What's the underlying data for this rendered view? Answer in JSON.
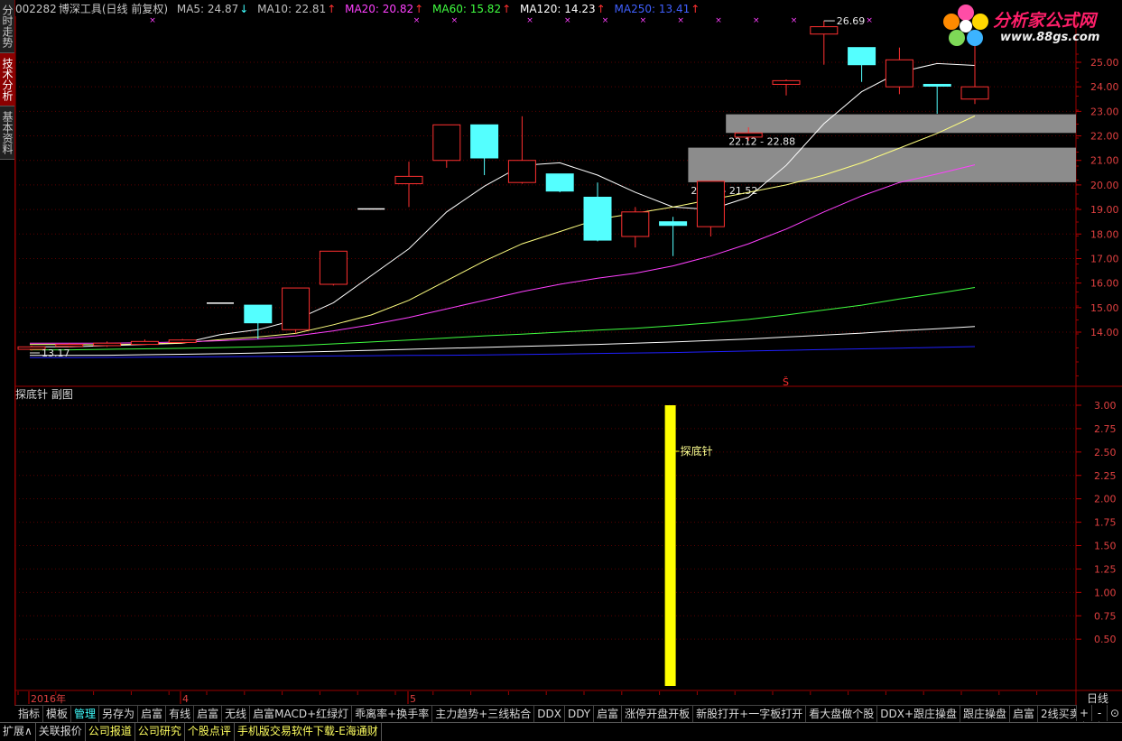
{
  "side_tabs": [
    {
      "label": "分时走势",
      "active": false
    },
    {
      "label": "技术分析",
      "active": true
    },
    {
      "label": "基本资料",
      "active": false
    }
  ],
  "header": {
    "code": "002282",
    "name": "博深工具",
    "mode": "(日线 前复权)",
    "ma": [
      {
        "label": "MA5: 24.87",
        "dir": "↓",
        "color": "#ffffff"
      },
      {
        "label": "MA10: 22.81",
        "dir": "↑",
        "color": "#ffffff"
      },
      {
        "label": "MA20: 20.82",
        "dir": "↑",
        "color": "#ff40ff"
      },
      {
        "label": "MA60: 15.82",
        "dir": "↑",
        "color": "#40ff40"
      },
      {
        "label": "MA120: 14.23",
        "dir": "↑",
        "color": "#ffffff"
      },
      {
        "label": "MA250: 13.41",
        "dir": "↑",
        "color": "#4040ff"
      }
    ]
  },
  "logo": {
    "title": "分析家公式网",
    "url": "www.88gs.com"
  },
  "chart_data": [
    {
      "type": "candlestick",
      "title": "",
      "ylim": [
        12.9,
        26.4
      ],
      "y_ticks": [
        14.0,
        15.0,
        16.0,
        17.0,
        18.0,
        19.0,
        20.0,
        21.0,
        22.0,
        23.0,
        24.0,
        25.0
      ],
      "x_labels": [
        {
          "index": 0,
          "label": "2016年"
        },
        {
          "index": 6,
          "label": "4"
        },
        {
          "index": 15,
          "label": "5"
        }
      ],
      "candles": [
        {
          "o": 13.3,
          "c": 13.4,
          "h": 13.45,
          "l": 13.25,
          "color": "red"
        },
        {
          "o": 13.42,
          "c": 13.5,
          "h": 13.55,
          "l": 13.38,
          "color": "red"
        },
        {
          "o": 13.45,
          "c": 13.55,
          "h": 13.62,
          "l": 13.4,
          "color": "red"
        },
        {
          "o": 13.5,
          "c": 13.62,
          "h": 13.7,
          "l": 13.48,
          "color": "red"
        },
        {
          "o": 13.58,
          "c": 13.68,
          "h": 13.72,
          "l": 13.55,
          "color": "red"
        },
        {
          "o": 15.18,
          "c": 15.18,
          "h": 15.18,
          "l": 15.18,
          "color": "white"
        },
        {
          "o": 15.1,
          "c": 14.38,
          "h": 15.1,
          "l": 13.72,
          "color": "cyan"
        },
        {
          "o": 14.1,
          "c": 15.8,
          "h": 15.8,
          "l": 13.95,
          "color": "red"
        },
        {
          "o": 15.95,
          "c": 17.3,
          "h": 17.3,
          "l": 15.9,
          "color": "red"
        },
        {
          "o": 19.02,
          "c": 19.02,
          "h": 19.02,
          "l": 19.02,
          "color": "white"
        },
        {
          "o": 20.05,
          "c": 20.35,
          "h": 20.95,
          "l": 19.1,
          "color": "red"
        },
        {
          "o": 21.0,
          "c": 22.45,
          "h": 22.45,
          "l": 20.7,
          "color": "red"
        },
        {
          "o": 22.45,
          "c": 21.1,
          "h": 22.45,
          "l": 20.4,
          "color": "cyan"
        },
        {
          "o": 20.1,
          "c": 21.0,
          "h": 22.8,
          "l": 20.05,
          "color": "red"
        },
        {
          "o": 20.45,
          "c": 19.75,
          "h": 20.45,
          "l": 19.7,
          "color": "cyan"
        },
        {
          "o": 19.5,
          "c": 17.75,
          "h": 20.1,
          "l": 17.7,
          "color": "cyan"
        },
        {
          "o": 17.9,
          "c": 18.9,
          "h": 19.1,
          "l": 17.45,
          "color": "red"
        },
        {
          "o": 18.5,
          "c": 18.35,
          "h": 18.7,
          "l": 17.1,
          "color": "cyan"
        },
        {
          "o": 18.3,
          "c": 20.15,
          "h": 20.15,
          "l": 17.9,
          "color": "red"
        },
        {
          "o": 21.95,
          "c": 22.12,
          "h": 22.35,
          "l": 21.8,
          "color": "red"
        },
        {
          "o": 24.1,
          "c": 24.25,
          "h": 24.3,
          "l": 23.65,
          "color": "red"
        },
        {
          "o": 26.15,
          "c": 26.45,
          "h": 26.69,
          "l": 24.9,
          "color": "red"
        },
        {
          "o": 25.6,
          "c": 24.9,
          "h": 25.6,
          "l": 24.2,
          "color": "cyan"
        },
        {
          "o": 24.0,
          "c": 25.1,
          "h": 25.6,
          "l": 23.7,
          "color": "red"
        },
        {
          "o": 24.1,
          "c": 24.1,
          "h": 24.1,
          "l": 22.9,
          "color": "cyan"
        },
        {
          "o": 23.5,
          "c": 24.0,
          "h": 25.7,
          "l": 23.3,
          "color": "red"
        }
      ],
      "series": [
        {
          "name": "MA5",
          "color": "#ffffff",
          "values": [
            null,
            13.4,
            13.45,
            13.5,
            13.55,
            13.9,
            14.1,
            14.5,
            15.2,
            16.3,
            17.4,
            18.9,
            19.95,
            20.8,
            20.9,
            20.4,
            19.7,
            19.1,
            19.0,
            19.5,
            20.8,
            22.5,
            23.8,
            24.6,
            24.95,
            24.87
          ]
        },
        {
          "name": "MA10",
          "color": "#ffff80",
          "values": [
            null,
            13.5,
            13.48,
            13.52,
            13.56,
            13.7,
            13.8,
            13.95,
            14.3,
            14.7,
            15.3,
            16.1,
            16.9,
            17.6,
            18.1,
            18.6,
            18.85,
            19.1,
            19.4,
            19.7,
            20.0,
            20.4,
            20.9,
            21.5,
            22.1,
            22.81
          ]
        },
        {
          "name": "MA20",
          "color": "#ff40ff",
          "values": [
            null,
            13.55,
            13.55,
            13.57,
            13.6,
            13.65,
            13.72,
            13.85,
            14.05,
            14.3,
            14.6,
            14.95,
            15.3,
            15.65,
            15.95,
            16.2,
            16.4,
            16.7,
            17.1,
            17.6,
            18.2,
            18.9,
            19.55,
            20.1,
            20.45,
            20.82
          ]
        },
        {
          "name": "MA60",
          "color": "#40ff40",
          "values": [
            null,
            13.28,
            13.3,
            13.32,
            13.34,
            13.37,
            13.4,
            13.45,
            13.52,
            13.6,
            13.68,
            13.76,
            13.85,
            13.92,
            14.0,
            14.08,
            14.16,
            14.26,
            14.38,
            14.52,
            14.7,
            14.9,
            15.1,
            15.35,
            15.58,
            15.82
          ]
        },
        {
          "name": "MA120",
          "color": "#ffffff",
          "values": [
            null,
            13.05,
            13.06,
            13.08,
            13.1,
            13.12,
            13.15,
            13.18,
            13.22,
            13.26,
            13.3,
            13.34,
            13.38,
            13.42,
            13.46,
            13.5,
            13.55,
            13.6,
            13.66,
            13.72,
            13.8,
            13.88,
            13.96,
            14.06,
            14.14,
            14.23
          ]
        },
        {
          "name": "MA250",
          "color": "#2020ff",
          "values": [
            null,
            12.96,
            12.97,
            12.98,
            12.99,
            13.0,
            13.01,
            13.02,
            13.03,
            13.04,
            13.05,
            13.06,
            13.07,
            13.09,
            13.11,
            13.13,
            13.15,
            13.17,
            13.2,
            13.23,
            13.26,
            13.29,
            13.32,
            13.35,
            13.38,
            13.41
          ]
        }
      ],
      "zones": [
        {
          "low": 20.11,
          "high": 21.52,
          "start_index": 18,
          "label": "20.11 - 21.52"
        },
        {
          "low": 22.12,
          "high": 22.88,
          "start_index": 19,
          "label": "22.12 - 22.88"
        }
      ],
      "annotations": {
        "high_label": "26.69",
        "low_label": "13.17"
      }
    },
    {
      "type": "bar",
      "title": "探底针 副图",
      "ylim": [
        0,
        3.25
      ],
      "y_ticks": [
        0.5,
        0.75,
        1.0,
        1.25,
        1.5,
        1.75,
        2.0,
        2.25,
        2.5,
        2.75,
        3.0
      ],
      "bars": [
        {
          "index": 17,
          "value": 3.0,
          "color": "#ffff00"
        }
      ],
      "bar_label": "探底针"
    }
  ],
  "period_label": "日线",
  "tabbar": [
    "指标",
    "模板",
    "管理",
    "另存为",
    "启富",
    "有线",
    "启富",
    "无线",
    "启富MACD+红绿灯",
    "乖离率+换手率",
    "主力趋势+三线粘合",
    "DDX",
    "DDY",
    "启富",
    "涨停开盘开板",
    "新股打开+一字板打开",
    "看大盘做个股",
    "DDX+跟庄操盘",
    "跟庄操盘",
    "启富",
    "2线买卖",
    ">"
  ],
  "tabbar_active": 2,
  "nav": [
    "+",
    "-",
    "⊙"
  ],
  "statusbar": [
    "扩展∧",
    "关联报价",
    "公司报道",
    "公司研究",
    "个股点评",
    "手机版交易软件下载-E海通财"
  ]
}
